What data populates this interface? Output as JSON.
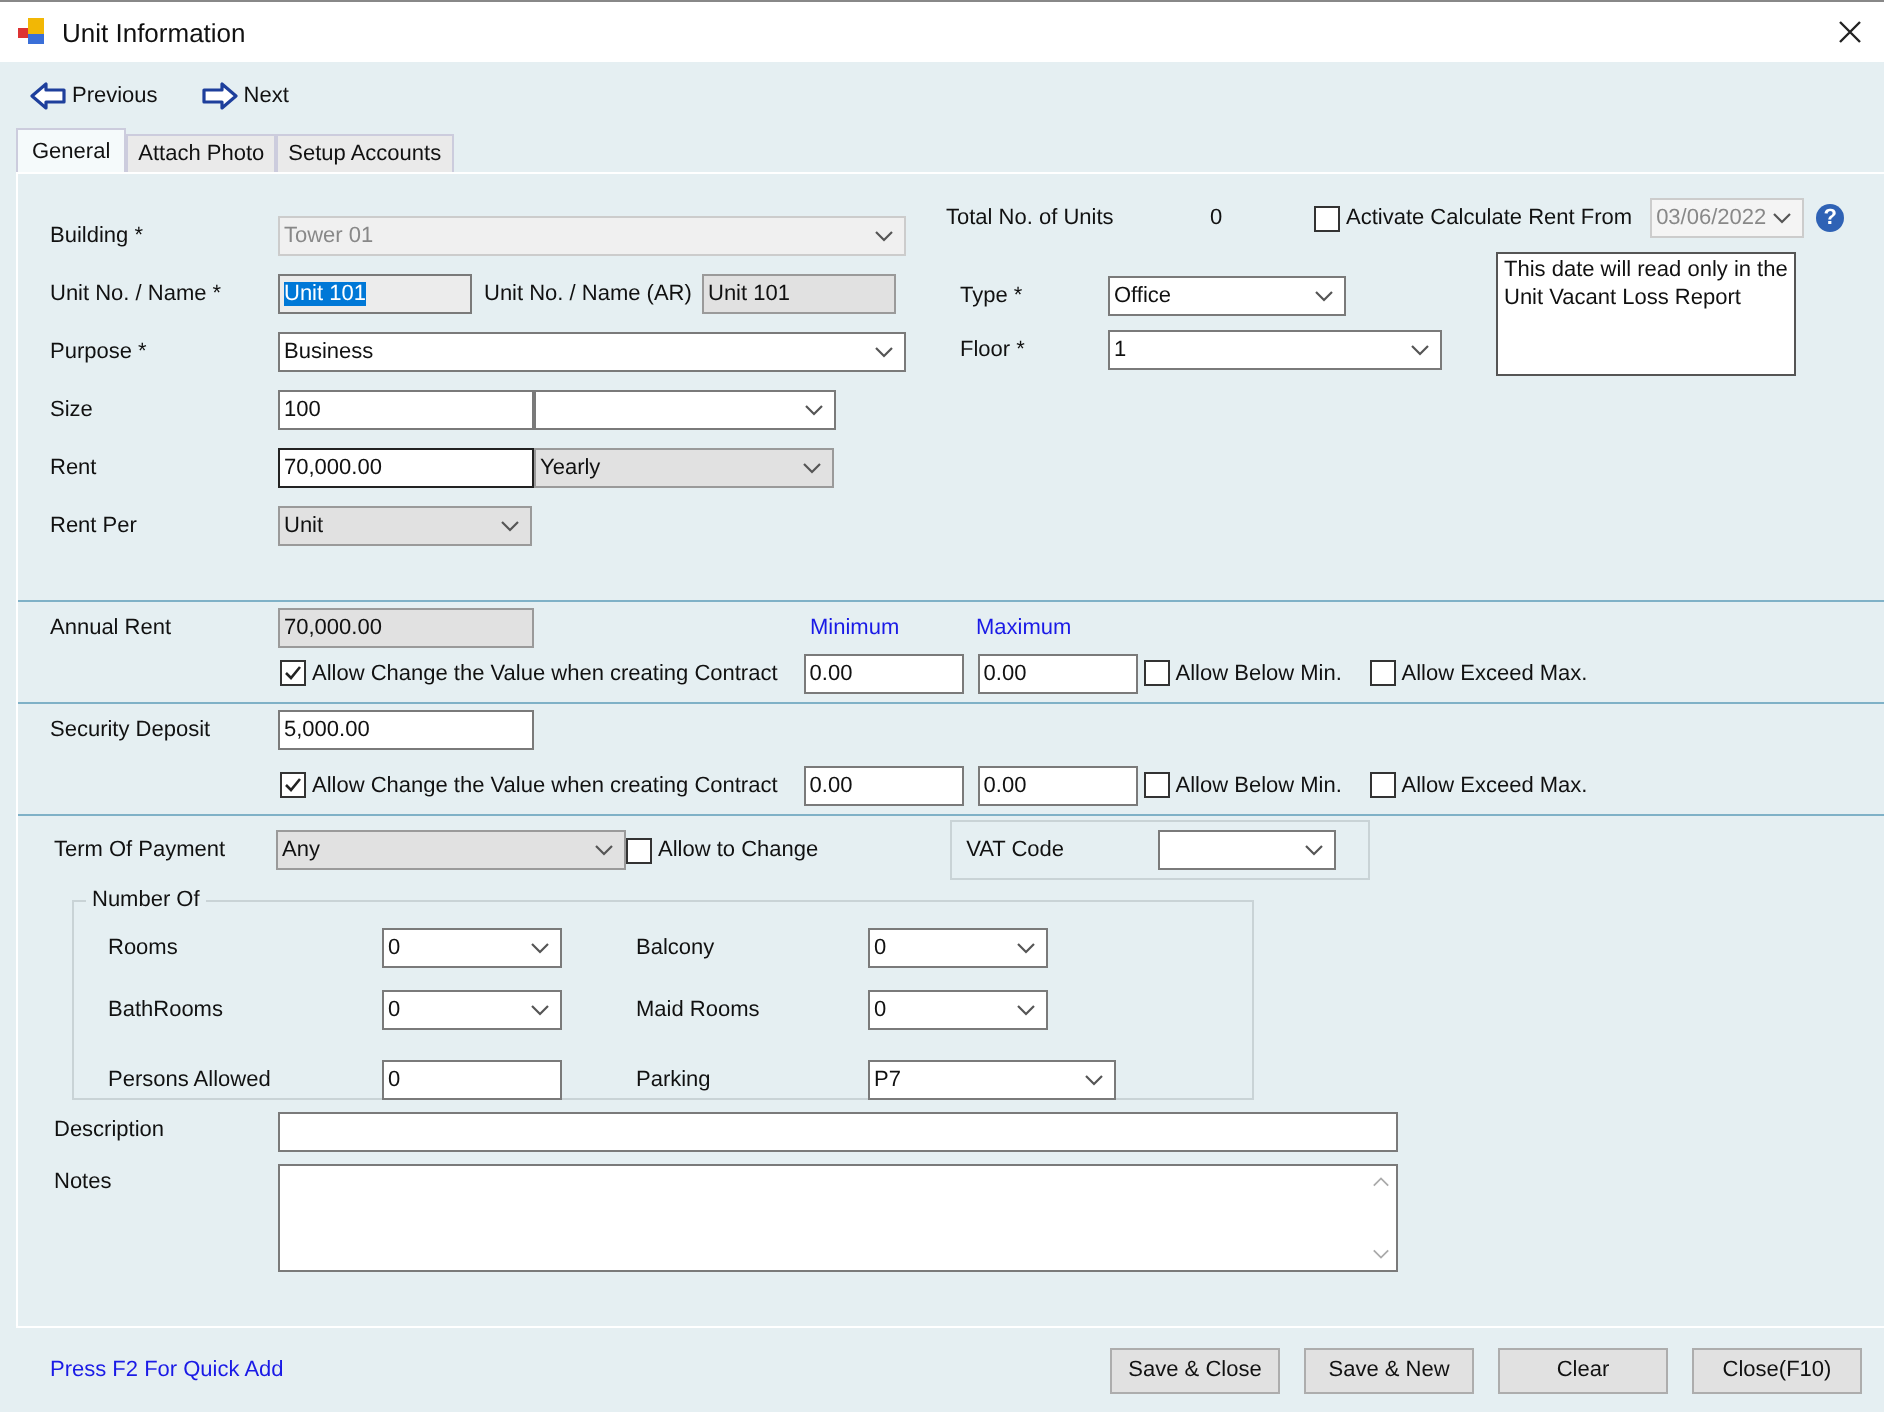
{
  "window": {
    "title": "Unit  Information"
  },
  "nav": [
    {
      "label": "Previous",
      "kind": "previous"
    },
    {
      "label": "Next",
      "kind": "next"
    }
  ],
  "tabs": [
    {
      "label": "General",
      "selected": true
    },
    {
      "label": "Attach Photo",
      "selected": false
    },
    {
      "label": "Setup Accounts",
      "selected": false
    }
  ],
  "general": {
    "building": {
      "label": "Building *",
      "value": "Tower 01",
      "disabled": true
    },
    "unit_name": {
      "label": "Unit No. / Name *",
      "value": "Unit 101",
      "text_selected": true
    },
    "unit_name_ar": {
      "label": "Unit No. / Name (AR)",
      "value": "Unit 101",
      "read_only": true
    },
    "purpose": {
      "label": "Purpose *",
      "value": "Business"
    },
    "size": {
      "label": "Size",
      "value": "100"
    },
    "rent": {
      "label": "Rent",
      "value": "70,000.00",
      "period": "Yearly",
      "period_read_only": true
    },
    "rent_per": {
      "label": "Rent Per",
      "value": "Unit",
      "read_only": true
    },
    "total_units": {
      "label": "Total No. of Units",
      "value": "0"
    },
    "activate_rent": {
      "label": "Activate Calculate Rent From",
      "checked": false,
      "date": "03/06/2022",
      "help": "?"
    },
    "date_note": "This date will read only in the Unit Vacant Loss Report",
    "type": {
      "label": "Type *",
      "value": "Office"
    },
    "floor": {
      "label": "Floor *",
      "value": "1"
    }
  },
  "min_max_headers": [
    "Minimum",
    "Maximum"
  ],
  "amounts": [
    {
      "label": "Annual Rent",
      "value": "70,000.00",
      "read_only": true,
      "allow_change": {
        "label": "Allow Change the Value when creating Contract",
        "checked": true
      },
      "minimum": "0.00",
      "maximum": "0.00",
      "allow_below": {
        "label": "Allow Below Min.",
        "checked": false
      },
      "allow_exceed": {
        "label": "Allow Exceed Max.",
        "checked": false
      }
    },
    {
      "label": "Security Deposit",
      "value": "5,000.00",
      "read_only": false,
      "allow_change": {
        "label": "Allow Change the Value when creating Contract",
        "checked": true
      },
      "minimum": "0.00",
      "maximum": "0.00",
      "allow_below": {
        "label": "Allow Below Min.",
        "checked": false
      },
      "allow_exceed": {
        "label": "Allow Exceed Max.",
        "checked": false
      }
    }
  ],
  "term_of_payment": {
    "label": "Term Of Payment",
    "value": "Any",
    "read_only": true,
    "allow_change": {
      "label": "Allow to Change",
      "checked": false
    }
  },
  "vat_code": {
    "label": "VAT Code"
  },
  "number_of": {
    "title": "Number Of",
    "items": [
      {
        "label": "Rooms",
        "value": "0",
        "kind": "combo"
      },
      {
        "label": "Balcony",
        "value": "0",
        "kind": "combo"
      },
      {
        "label": "BathRooms",
        "value": "0",
        "kind": "combo"
      },
      {
        "label": "Maid Rooms",
        "value": "0",
        "kind": "combo"
      },
      {
        "label": "Persons Allowed",
        "value": "0",
        "kind": "input"
      },
      {
        "label": "Parking",
        "value": "P7",
        "kind": "wide-combo"
      }
    ]
  },
  "description": {
    "label": "Description"
  },
  "notes": {
    "label": "Notes"
  },
  "footer": {
    "hint": "Press F2 For Quick Add",
    "buttons": [
      "Save & Close",
      "Save & New",
      "Clear",
      "Close(F10)"
    ]
  }
}
